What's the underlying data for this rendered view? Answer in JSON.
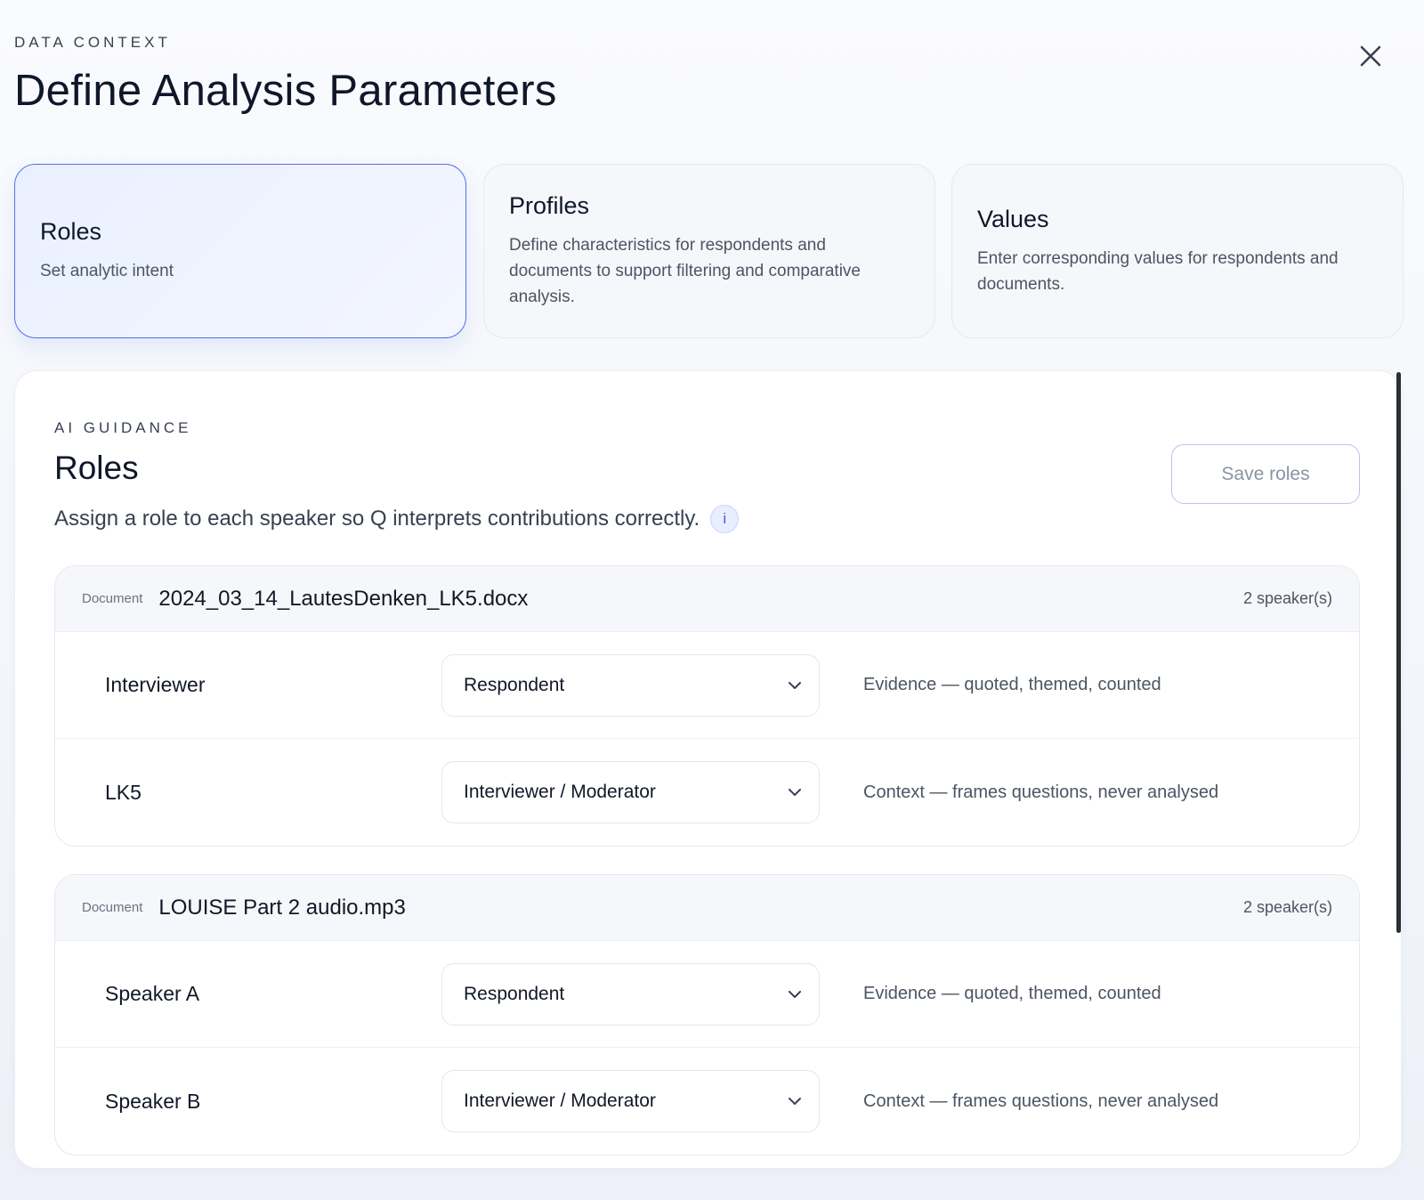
{
  "header": {
    "eyebrow": "DATA CONTEXT",
    "title": "Define Analysis Parameters"
  },
  "steps": [
    {
      "title": "Roles",
      "description": "Set analytic intent",
      "active": true
    },
    {
      "title": "Profiles",
      "description": "Define characteristics for respondents and documents to support filtering and comparative analysis.",
      "active": false
    },
    {
      "title": "Values",
      "description": "Enter corresponding values for respondents and documents.",
      "active": false
    }
  ],
  "panel": {
    "eyebrow": "AI GUIDANCE",
    "title": "Roles",
    "subtitle": "Assign a role to each speaker so Q interprets contributions correctly.",
    "info_label": "i",
    "save_label": "Save roles"
  },
  "documents": [
    {
      "tag": "Document",
      "name": "2024_03_14_LautesDenken_LK5.docx",
      "count": "2 speaker(s)",
      "speakers": [
        {
          "name": "Interviewer",
          "role": "Respondent",
          "effect": "Evidence — quoted, themed, counted"
        },
        {
          "name": "LK5",
          "role": "Interviewer / Moderator",
          "effect": "Context — frames questions, never analysed"
        }
      ]
    },
    {
      "tag": "Document",
      "name": "LOUISE Part 2 audio.mp3",
      "count": "2 speaker(s)",
      "speakers": [
        {
          "name": "Speaker A",
          "role": "Respondent",
          "effect": "Evidence — quoted, themed, counted"
        },
        {
          "name": "Speaker B",
          "role": "Interviewer / Moderator",
          "effect": "Context — frames questions, never analysed"
        }
      ]
    }
  ],
  "colors": {
    "accent": "#4f72e3",
    "text": "#0f172a",
    "muted": "#4b5563"
  },
  "icons": [
    "close-icon",
    "info-icon",
    "chevron-down-icon"
  ]
}
